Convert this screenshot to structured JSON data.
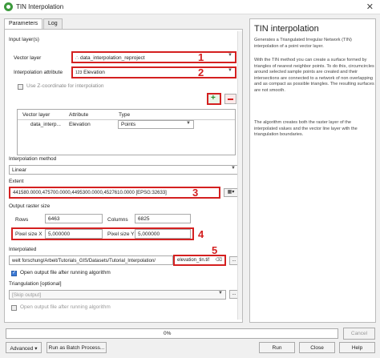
{
  "window": {
    "title": "TIN Interpolation",
    "close_glyph": "✕"
  },
  "tabs": [
    {
      "label": "Parameters"
    },
    {
      "label": "Log"
    }
  ],
  "params": {
    "input_layers_label": "Input layer(s)",
    "vector_layer_label": "Vector layer",
    "vector_layer_value": "data_interpolation_reproject",
    "interp_attr_label": "Interpolation attribute",
    "interp_attr_prefix": "123",
    "interp_attr_value": "Elevation",
    "use_z_label": "Use Z-coordinate for interpolation",
    "table_headers": [
      "Vector layer",
      "Attribute",
      "Type"
    ],
    "table_row": {
      "layer": "data_interp...",
      "attribute": "Elevation",
      "type": "Points"
    },
    "method_label": "Interpolation method",
    "method_value": "Linear",
    "extent_label": "Extent",
    "extent_value": "441580.0000,475700.0000,4495300.0000,4527610.0000 [EPSG:32633]",
    "output_raster_label": "Output raster size",
    "rows_label": "Rows",
    "rows_value": "6463",
    "columns_label": "Columns",
    "columns_value": "6825",
    "pixel_x_label": "Pixel size X",
    "pixel_x_value": "5,000000",
    "pixel_y_label": "Pixel size Y",
    "pixel_y_value": "5,000000",
    "interpolated_label": "Interpolated",
    "interpolated_path": "welt forschung/Arbeit/Tutorials_GIS/Datasets/Tutorial_Interpolation/",
    "interpolated_file": "elevation_tin.tif",
    "open_output_label": "Open output file after running algorithm",
    "triangulation_label": "Triangulation [optional]",
    "triangulation_placeholder": "[Skip output]",
    "open_output2_label": "Open output file after running algorithm",
    "browse_label": "..."
  },
  "annotations": [
    "1",
    "2",
    "3",
    "4",
    "5"
  ],
  "help": {
    "title": "TIN interpolation",
    "p1": "Generates a Triangulated Irregular Network (TIN) interpolation of a point vector layer.",
    "p2": "With the TIN method you can create a surface formed by triangles of nearest neighbor points. To do this, circumcircles around selected sample points are created and their intersections are connected to a network of non overlapping and as compact as possible triangles. The resulting surfaces are not smooth.",
    "p3": "The algorithm creates both the raster layer of the interpolated values and the vector line layer with the triangulation boundaries."
  },
  "footer": {
    "progress_text": "0%",
    "progress": 0,
    "cancel_label": "Cancel",
    "advanced_label": "Advanced",
    "batch_label": "Run as Batch Process...",
    "run_label": "Run",
    "close_label": "Close",
    "help_label": "Help"
  },
  "colors": {
    "accent_red": "#d42020",
    "qgis_green": "#3d9a3d"
  }
}
